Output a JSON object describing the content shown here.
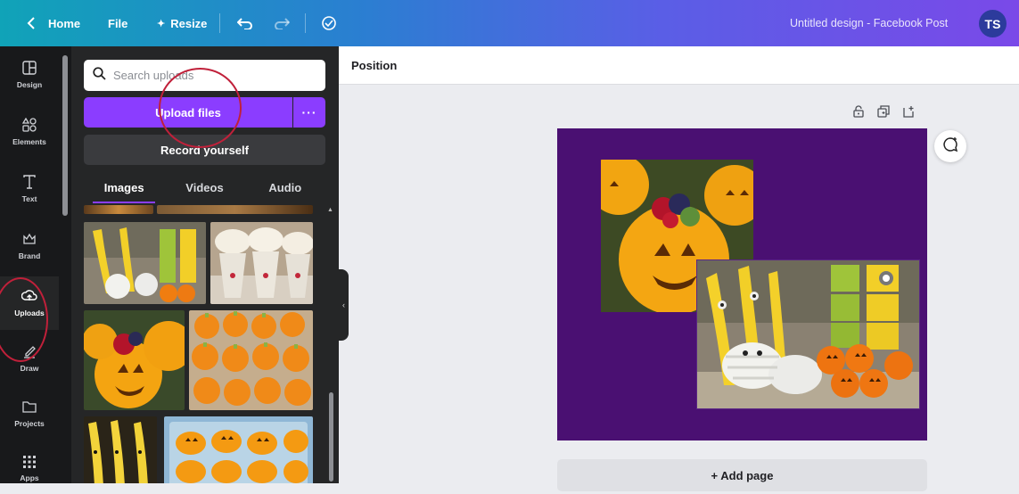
{
  "topbar": {
    "home_label": "Home",
    "file_label": "File",
    "resize_label": "Resize",
    "title": "Untitled design - Facebook Post",
    "avatar_initials": "TS",
    "gradient_start": "#10a3b8",
    "gradient_end": "#7a49e8"
  },
  "rail": {
    "items": [
      {
        "label": "Design",
        "icon": "layout-icon"
      },
      {
        "label": "Elements",
        "icon": "shapes-icon"
      },
      {
        "label": "Text",
        "icon": "text-icon"
      },
      {
        "label": "Brand",
        "icon": "crown-icon"
      },
      {
        "label": "Uploads",
        "icon": "cloud-upload-icon"
      },
      {
        "label": "Draw",
        "icon": "pen-icon"
      },
      {
        "label": "Projects",
        "icon": "folder-icon"
      },
      {
        "label": "Apps",
        "icon": "grid-icon"
      }
    ],
    "active": "Uploads"
  },
  "panel": {
    "search_placeholder": "Search uploads",
    "upload_label": "Upload files",
    "more_label": "···",
    "record_label": "Record yourself",
    "tabs": [
      {
        "label": "Images",
        "active": true
      },
      {
        "label": "Videos",
        "active": false
      },
      {
        "label": "Audio",
        "active": false
      }
    ],
    "accent": "#8b3dff"
  },
  "editor": {
    "toolbar_label": "Position",
    "add_page_label": "+ Add page",
    "canvas_color": "#4a1072"
  }
}
